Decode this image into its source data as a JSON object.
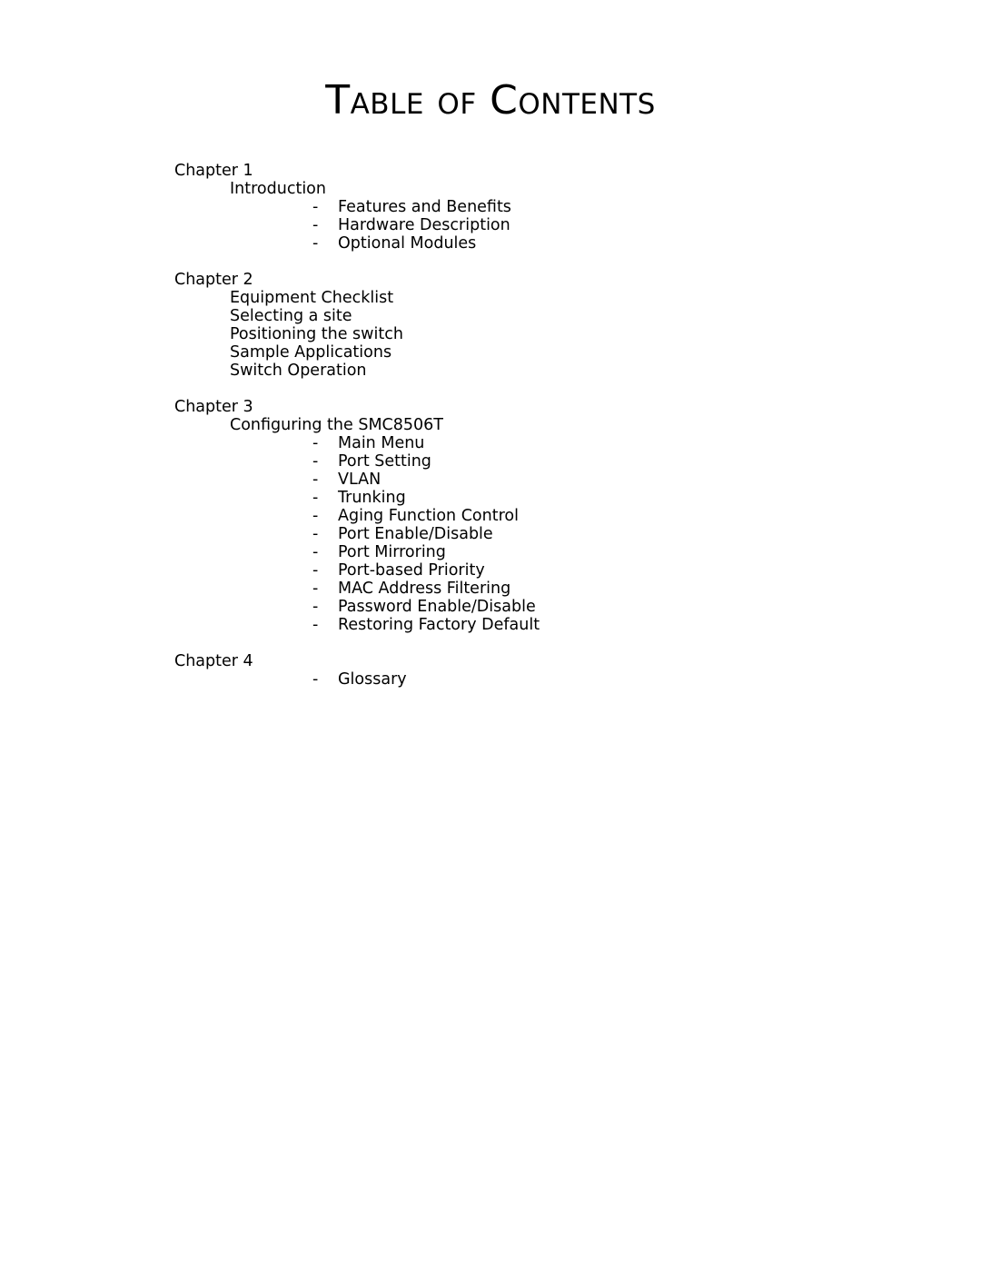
{
  "document": {
    "title": "Table of Contents",
    "bullet_dash": "-"
  },
  "toc": {
    "chapters": [
      {
        "label": "Chapter 1",
        "entries": [
          {
            "level": 1,
            "text": "Introduction"
          },
          {
            "level": 2,
            "text": "Features and Benefits"
          },
          {
            "level": 2,
            "text": "Hardware Description"
          },
          {
            "level": 2,
            "text": "Optional Modules"
          }
        ]
      },
      {
        "label": "Chapter 2",
        "entries": [
          {
            "level": 1,
            "text": "Equipment Checklist"
          },
          {
            "level": 1,
            "text": "Selecting a site"
          },
          {
            "level": 1,
            "text": "Positioning the switch"
          },
          {
            "level": 1,
            "text": "Sample Applications"
          },
          {
            "level": 1,
            "text": "Switch Operation"
          }
        ]
      },
      {
        "label": "Chapter 3",
        "entries": [
          {
            "level": 1,
            "text": "Configuring the SMC8506T"
          },
          {
            "level": 2,
            "text": "Main Menu"
          },
          {
            "level": 2,
            "text": "Port Setting"
          },
          {
            "level": 2,
            "text": "VLAN"
          },
          {
            "level": 2,
            "text": "Trunking"
          },
          {
            "level": 2,
            "text": "Aging Function Control"
          },
          {
            "level": 2,
            "text": "Port Enable/Disable"
          },
          {
            "level": 2,
            "text": "Port Mirroring"
          },
          {
            "level": 2,
            "text": "Port-based Priority"
          },
          {
            "level": 2,
            "text": "MAC Address Filtering"
          },
          {
            "level": 2,
            "text": "Password Enable/Disable"
          },
          {
            "level": 2,
            "text": "Restoring Factory Default"
          }
        ]
      },
      {
        "label": "Chapter 4",
        "entries": [
          {
            "level": 2,
            "text": "Glossary"
          }
        ]
      }
    ]
  },
  "colors": {
    "page_background": "#ffffff",
    "text": "#000000"
  }
}
